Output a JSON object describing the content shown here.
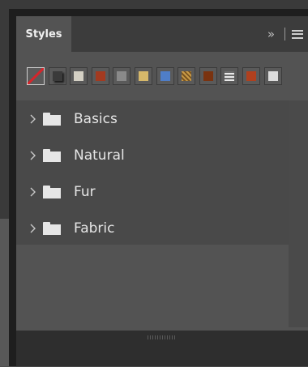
{
  "panel": {
    "tab_title": "Styles",
    "menu_collapse_glyph": "»",
    "menu_icon": "hamburger-icon"
  },
  "swatches": [
    {
      "name": "none",
      "color": "#ffffff"
    },
    {
      "name": "drop-shadow",
      "color": "#3a3a3a"
    },
    {
      "name": "light-gray",
      "color": "#d4d0c4"
    },
    {
      "name": "red-brick",
      "color": "#a33a20"
    },
    {
      "name": "gray",
      "color": "#8a8a8a"
    },
    {
      "name": "gold",
      "color": "#d6b86a"
    },
    {
      "name": "blue",
      "color": "#4f7ec8"
    },
    {
      "name": "pattern",
      "color": "#c89a46"
    },
    {
      "name": "brown",
      "color": "#7a3310"
    },
    {
      "name": "rings",
      "color": "#cfcfcf"
    },
    {
      "name": "rust",
      "color": "#b0401e"
    },
    {
      "name": "off-white",
      "color": "#dcdcdc"
    }
  ],
  "groups": [
    {
      "label": "Basics"
    },
    {
      "label": "Natural"
    },
    {
      "label": "Fur"
    },
    {
      "label": "Fabric"
    }
  ],
  "footer": {
    "icons": [
      "new-group-folder-icon",
      "new-style-icon",
      "delete-icon"
    ]
  }
}
